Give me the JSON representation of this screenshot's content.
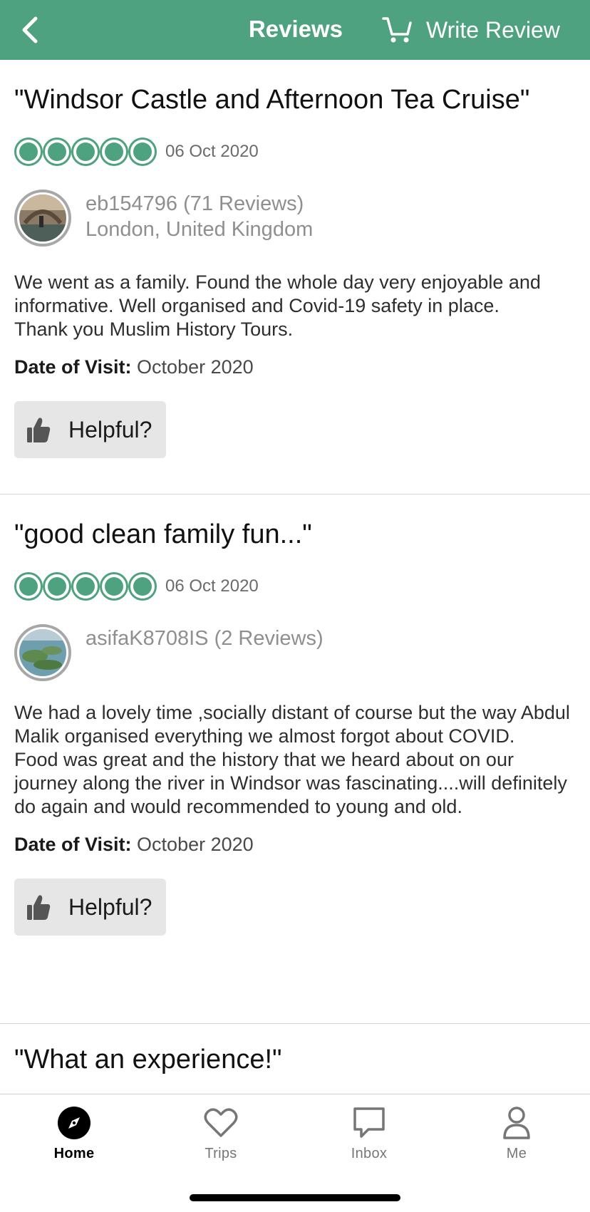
{
  "header": {
    "title": "Reviews",
    "write_review_label": "Write Review",
    "brand_color": "#4fa27f"
  },
  "reviews": [
    {
      "title": "\"Windsor Castle and Afternoon Tea Cruise\"",
      "rating": 5,
      "date": "06 Oct 2020",
      "reviewer_name": "eb154796 (71 Reviews)",
      "reviewer_location": "London, United Kingdom",
      "body": "We went as a family. Found the whole day very enjoyable and informative.  Well organised and Covid-19 safety in place.\nThank you Muslim History Tours.",
      "visit_label": "Date of Visit:",
      "visit_value": "October 2020",
      "helpful_label": "Helpful?"
    },
    {
      "title": "\"good clean family fun...\"",
      "rating": 5,
      "date": "06 Oct 2020",
      "reviewer_name": "asifaK8708IS (2 Reviews)",
      "reviewer_location": "",
      "body": "We had a lovely time ,socially distant of course but the way Abdul Malik organised everything we almost forgot about COVID.\nFood was great and the history that we heard about on our journey along the river in Windsor was fascinating....will definitely do again and would recommended to young and old.",
      "visit_label": "Date of Visit:",
      "visit_value": "October 2020",
      "helpful_label": "Helpful?"
    },
    {
      "title": "\"What an experience!\""
    }
  ],
  "bottom_nav": {
    "items": [
      {
        "label": "Home",
        "icon": "compass-icon",
        "active": true
      },
      {
        "label": "Trips",
        "icon": "heart-icon",
        "active": false
      },
      {
        "label": "Inbox",
        "icon": "chat-bubble-icon",
        "active": false
      },
      {
        "label": "Me",
        "icon": "person-icon",
        "active": false
      }
    ]
  }
}
